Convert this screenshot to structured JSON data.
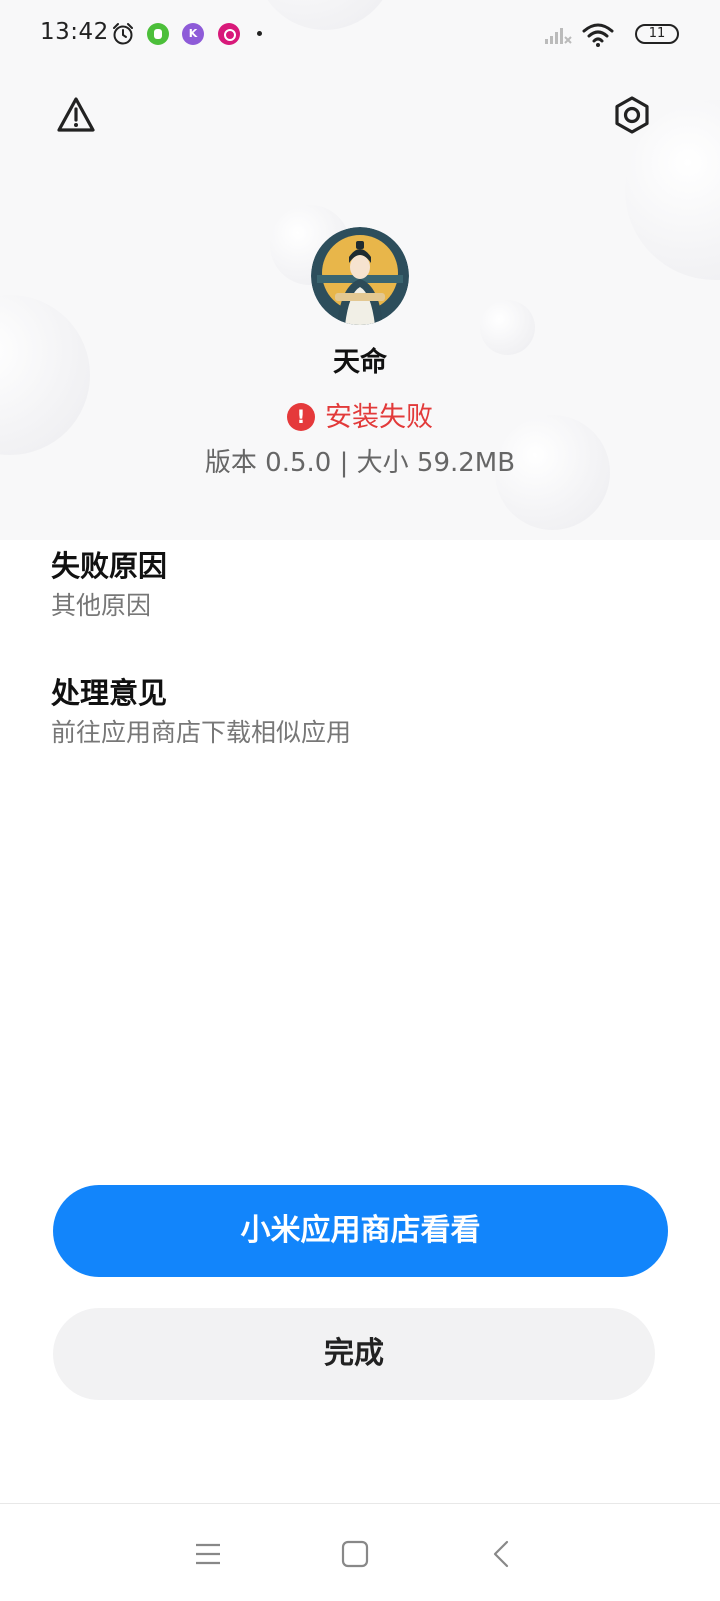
{
  "status_bar": {
    "time": "13:42",
    "battery": "11",
    "icons": [
      "alarm-icon",
      "green-app-icon",
      "purple-app-icon",
      "pink-app-icon",
      "dot-icon",
      "signal-icon",
      "wifi-icon",
      "battery-icon"
    ]
  },
  "toolbar": {
    "left_icon": "warning-icon",
    "right_icon": "settings-icon"
  },
  "app": {
    "name": "天命",
    "status": "安装失败",
    "status_icon": "!",
    "meta": "版本 0.5.0 | 大小 59.2MB"
  },
  "failure": {
    "title": "失败原因",
    "text": "其他原因"
  },
  "advice": {
    "title": "处理意见",
    "text": "前往应用商店下载相似应用"
  },
  "buttons": {
    "primary": "小米应用商店看看",
    "secondary": "完成"
  },
  "nav": {
    "icons": [
      "menu-icon",
      "home-icon",
      "back-icon"
    ]
  },
  "colors": {
    "accent": "#1285fb",
    "error": "#e5393b",
    "secondary_bg": "#f2f2f3"
  }
}
